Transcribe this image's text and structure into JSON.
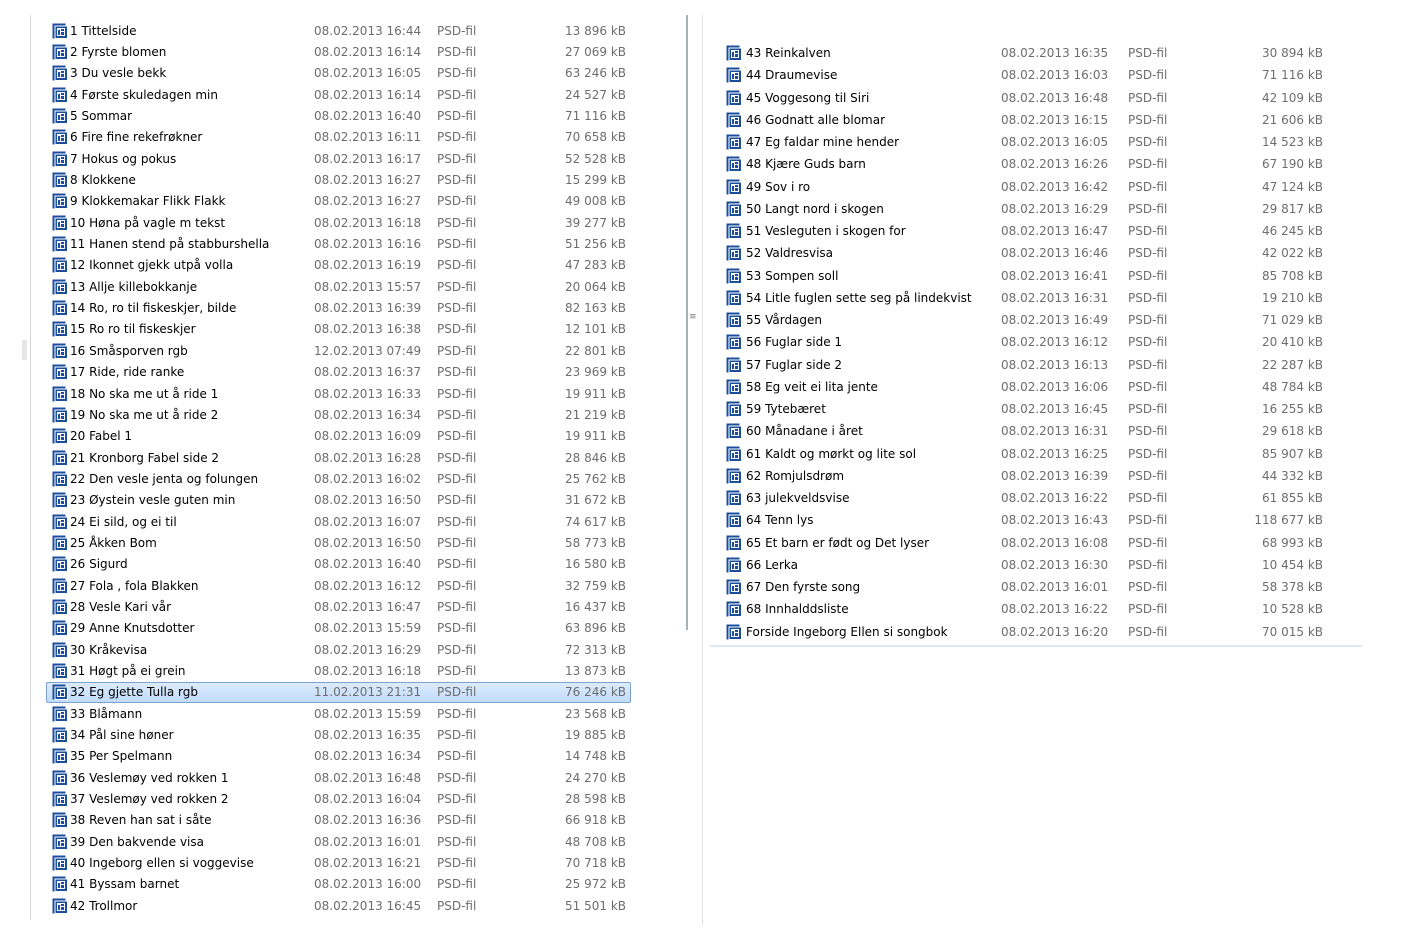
{
  "left_pane": {
    "files": [
      {
        "name": "1 Tittelside",
        "date": "08.02.2013 16:44",
        "type": "PSD-fil",
        "size": "13 896 kB"
      },
      {
        "name": "2  Fyrste blomen",
        "date": "08.02.2013 16:14",
        "type": "PSD-fil",
        "size": "27 069 kB"
      },
      {
        "name": "3  Du vesle bekk",
        "date": "08.02.2013 16:05",
        "type": "PSD-fil",
        "size": "63 246 kB"
      },
      {
        "name": "4  Første skuledagen min",
        "date": "08.02.2013 16:14",
        "type": "PSD-fil",
        "size": "24 527 kB"
      },
      {
        "name": "5 Sommar",
        "date": "08.02.2013 16:40",
        "type": "PSD-fil",
        "size": "71 116 kB"
      },
      {
        "name": "6  Fire fine rekefrøkner",
        "date": "08.02.2013 16:11",
        "type": "PSD-fil",
        "size": "70 658 kB"
      },
      {
        "name": "7 Hokus og pokus",
        "date": "08.02.2013 16:17",
        "type": "PSD-fil",
        "size": "52 528 kB"
      },
      {
        "name": "8 Klokkene",
        "date": "08.02.2013 16:27",
        "type": "PSD-fil",
        "size": "15 299 kB"
      },
      {
        "name": "9  Klokkemakar Flikk Flakk",
        "date": "08.02.2013 16:27",
        "type": "PSD-fil",
        "size": "49 008 kB"
      },
      {
        "name": "10 Høna på vagle m tekst",
        "date": "08.02.2013 16:18",
        "type": "PSD-fil",
        "size": "39 277 kB"
      },
      {
        "name": "11 Hanen stend på stabburshella",
        "date": "08.02.2013 16:16",
        "type": "PSD-fil",
        "size": "51 256 kB"
      },
      {
        "name": "12 Ikonnet gjekk utpå volla",
        "date": "08.02.2013 16:19",
        "type": "PSD-fil",
        "size": "47 283 kB"
      },
      {
        "name": "13 Allje killebokkanje",
        "date": "08.02.2013 15:57",
        "type": "PSD-fil",
        "size": "20 064 kB"
      },
      {
        "name": "14 Ro, ro til fiskeskjer,  bilde",
        "date": "08.02.2013 16:39",
        "type": "PSD-fil",
        "size": "82 163 kB"
      },
      {
        "name": "15 Ro ro til fiskeskjer",
        "date": "08.02.2013 16:38",
        "type": "PSD-fil",
        "size": "12 101 kB"
      },
      {
        "name": "16 Småsporven  rgb",
        "date": "12.02.2013 07:49",
        "type": "PSD-fil",
        "size": "22 801 kB"
      },
      {
        "name": "17 Ride, ride ranke",
        "date": "08.02.2013 16:37",
        "type": "PSD-fil",
        "size": "23 969 kB"
      },
      {
        "name": "18 No ska me ut å ride 1",
        "date": "08.02.2013 16:33",
        "type": "PSD-fil",
        "size": "19 911 kB"
      },
      {
        "name": "19 No ska me ut å ride 2",
        "date": "08.02.2013 16:34",
        "type": "PSD-fil",
        "size": "21 219 kB"
      },
      {
        "name": "20 Fabel 1",
        "date": "08.02.2013 16:09",
        "type": "PSD-fil",
        "size": "19 911 kB"
      },
      {
        "name": "21 Kronborg Fabel side 2",
        "date": "08.02.2013 16:28",
        "type": "PSD-fil",
        "size": "28 846 kB"
      },
      {
        "name": "22 Den vesle jenta og folungen",
        "date": "08.02.2013 16:02",
        "type": "PSD-fil",
        "size": "25 762 kB"
      },
      {
        "name": "23 Øystein vesle guten min",
        "date": "08.02.2013 16:50",
        "type": "PSD-fil",
        "size": "31 672 kB"
      },
      {
        "name": "24 Ei sild, og ei til",
        "date": "08.02.2013 16:07",
        "type": "PSD-fil",
        "size": "74 617 kB"
      },
      {
        "name": "25 Åkken Bom",
        "date": "08.02.2013 16:50",
        "type": "PSD-fil",
        "size": "58 773 kB"
      },
      {
        "name": "26 Sigurd",
        "date": "08.02.2013 16:40",
        "type": "PSD-fil",
        "size": "16 580 kB"
      },
      {
        "name": "27 Fola , fola Blakken",
        "date": "08.02.2013 16:12",
        "type": "PSD-fil",
        "size": "32 759 kB"
      },
      {
        "name": "28 Vesle Kari vår",
        "date": "08.02.2013 16:47",
        "type": "PSD-fil",
        "size": "16 437 kB"
      },
      {
        "name": "29 Anne Knutsdotter",
        "date": "08.02.2013 15:59",
        "type": "PSD-fil",
        "size": "63 896 kB"
      },
      {
        "name": "30 Kråkevisa",
        "date": "08.02.2013 16:29",
        "type": "PSD-fil",
        "size": "72 313 kB"
      },
      {
        "name": "31 Høgt på ei grein",
        "date": "08.02.2013 16:18",
        "type": "PSD-fil",
        "size": "13 873 kB"
      },
      {
        "name": "32 Eg gjette Tulla rgb",
        "date": "11.02.2013 21:31",
        "type": "PSD-fil",
        "size": "76 246 kB",
        "selected": true
      },
      {
        "name": "33 Blåmann",
        "date": "08.02.2013 15:59",
        "type": "PSD-fil",
        "size": "23 568 kB"
      },
      {
        "name": "34 Pål sine høner",
        "date": "08.02.2013 16:35",
        "type": "PSD-fil",
        "size": "19 885 kB"
      },
      {
        "name": "35 Per Spelmann",
        "date": "08.02.2013 16:34",
        "type": "PSD-fil",
        "size": "14 748 kB"
      },
      {
        "name": "36 Veslemøy ved rokken 1",
        "date": "08.02.2013 16:48",
        "type": "PSD-fil",
        "size": "24 270 kB"
      },
      {
        "name": "37 Veslemøy ved rokken 2",
        "date": "08.02.2013 16:04",
        "type": "PSD-fil",
        "size": "28 598 kB"
      },
      {
        "name": "38 Reven han sat i såte",
        "date": "08.02.2013 16:36",
        "type": "PSD-fil",
        "size": "66 918 kB"
      },
      {
        "name": "39 Den bakvende visa",
        "date": "08.02.2013 16:01",
        "type": "PSD-fil",
        "size": "48 708 kB"
      },
      {
        "name": "40 Ingeborg ellen si voggevise",
        "date": "08.02.2013 16:21",
        "type": "PSD-fil",
        "size": "70 718 kB"
      },
      {
        "name": "41 Byssam barnet",
        "date": "08.02.2013 16:00",
        "type": "PSD-fil",
        "size": "25 972 kB"
      },
      {
        "name": "42 Trollmor",
        "date": "08.02.2013 16:45",
        "type": "PSD-fil",
        "size": "51 501 kB"
      }
    ]
  },
  "right_pane": {
    "files": [
      {
        "name": "43 Reinkalven",
        "date": "08.02.2013 16:35",
        "type": "PSD-fil",
        "size": "30 894 kB"
      },
      {
        "name": "44 Draumevise",
        "date": "08.02.2013 16:03",
        "type": "PSD-fil",
        "size": "71 116 kB"
      },
      {
        "name": "45 Voggesong til Siri",
        "date": "08.02.2013 16:48",
        "type": "PSD-fil",
        "size": "42 109 kB"
      },
      {
        "name": "46 Godnatt alle blomar",
        "date": "08.02.2013 16:15",
        "type": "PSD-fil",
        "size": "21 606 kB"
      },
      {
        "name": "47 Eg faldar mine hender",
        "date": "08.02.2013 16:05",
        "type": "PSD-fil",
        "size": "14 523 kB"
      },
      {
        "name": "48 Kjære Guds barn",
        "date": "08.02.2013 16:26",
        "type": "PSD-fil",
        "size": "67 190 kB"
      },
      {
        "name": "49 Sov i ro",
        "date": "08.02.2013 16:42",
        "type": "PSD-fil",
        "size": "47 124 kB"
      },
      {
        "name": "50 Langt nord i skogen",
        "date": "08.02.2013 16:29",
        "type": "PSD-fil",
        "size": "29 817 kB"
      },
      {
        "name": "51 Vesleguten i skogen for",
        "date": "08.02.2013 16:47",
        "type": "PSD-fil",
        "size": "46 245 kB"
      },
      {
        "name": "52 Valdresvisa",
        "date": "08.02.2013 16:46",
        "type": "PSD-fil",
        "size": "42 022 kB"
      },
      {
        "name": "53 Sompen soll",
        "date": "08.02.2013 16:41",
        "type": "PSD-fil",
        "size": "85 708 kB"
      },
      {
        "name": "54 Litle fuglen sette seg på lindekvist",
        "date": "08.02.2013 16:31",
        "type": "PSD-fil",
        "size": "19 210 kB"
      },
      {
        "name": "55 Vårdagen",
        "date": "08.02.2013 16:49",
        "type": "PSD-fil",
        "size": "71 029 kB"
      },
      {
        "name": "56 Fuglar side 1",
        "date": "08.02.2013 16:12",
        "type": "PSD-fil",
        "size": "20 410 kB"
      },
      {
        "name": "57 Fuglar side 2",
        "date": "08.02.2013 16:13",
        "type": "PSD-fil",
        "size": "22 287 kB"
      },
      {
        "name": "58 Eg veit ei lita jente",
        "date": "08.02.2013 16:06",
        "type": "PSD-fil",
        "size": "48 784 kB"
      },
      {
        "name": "59 Tytebæret",
        "date": "08.02.2013 16:45",
        "type": "PSD-fil",
        "size": "16 255 kB"
      },
      {
        "name": "60 Månadane i året",
        "date": "08.02.2013 16:31",
        "type": "PSD-fil",
        "size": "29 618 kB"
      },
      {
        "name": "61 Kaldt og mørkt og lite sol",
        "date": "08.02.2013 16:25",
        "type": "PSD-fil",
        "size": "85 907 kB"
      },
      {
        "name": "62 Romjulsdrøm",
        "date": "08.02.2013 16:39",
        "type": "PSD-fil",
        "size": "44 332 kB"
      },
      {
        "name": "63 julekveldsvise",
        "date": "08.02.2013 16:22",
        "type": "PSD-fil",
        "size": "61 855 kB"
      },
      {
        "name": "64 Tenn lys",
        "date": "08.02.2013 16:43",
        "type": "PSD-fil",
        "size": "118 677 kB"
      },
      {
        "name": "65 Et barn er født og Det lyser",
        "date": "08.02.2013 16:08",
        "type": "PSD-fil",
        "size": "68 993 kB"
      },
      {
        "name": "66 Lerka",
        "date": "08.02.2013 16:30",
        "type": "PSD-fil",
        "size": "10 454 kB"
      },
      {
        "name": "67 Den fyrste song",
        "date": "08.02.2013 16:01",
        "type": "PSD-fil",
        "size": "58 378 kB"
      },
      {
        "name": "68 Innhalddsliste",
        "date": "08.02.2013 16:22",
        "type": "PSD-fil",
        "size": "10 528 kB"
      },
      {
        "name": "Forside Ingeborg Ellen si songbok",
        "date": "08.02.2013 16:20",
        "type": "PSD-fil",
        "size": "70 015 kB"
      }
    ]
  },
  "splitter": {
    "grip_glyph": "≡"
  },
  "icon": {
    "name": "psd-file-icon",
    "color": "#1b4f9c",
    "accent": "#ffffff"
  }
}
